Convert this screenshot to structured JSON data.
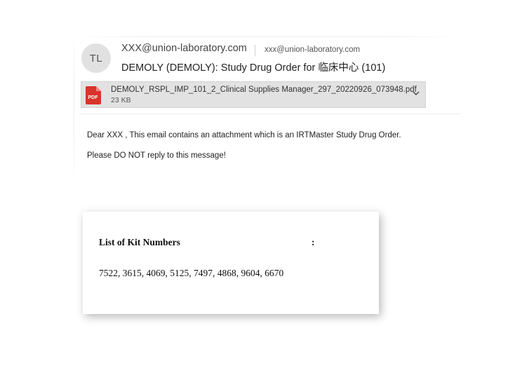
{
  "email": {
    "avatar_initials": "TL",
    "sender": "XXX@union-laboratory.com",
    "recipient": "xxx@union-laboratory.com",
    "subject": "DEMOLY (DEMOLY): Study Drug Order for 临床中心 (101)",
    "attachment": {
      "icon": "pdf-file-icon",
      "badge": "PDF",
      "filename": "DEMOLY_RSPL_IMP_101_2_Clinical Supplies Manager_297_20220926_073948.pdf",
      "size": "23 KB"
    },
    "body_line1": "Dear  XXX , This email contains an attachment which is an IRTMaster Study Drug Order.",
    "body_line2": "Please DO NOT reply to this message!"
  },
  "kit_card": {
    "title": "List of Kit Numbers",
    "colon": ":",
    "values": "7522, 3615, 4069, 5125, 7497, 4868, 9604, 6670"
  },
  "colors": {
    "pdf_red": "#d9342b",
    "attachment_bg": "#e2e2e2",
    "avatar_bg": "#e1e1e1"
  }
}
